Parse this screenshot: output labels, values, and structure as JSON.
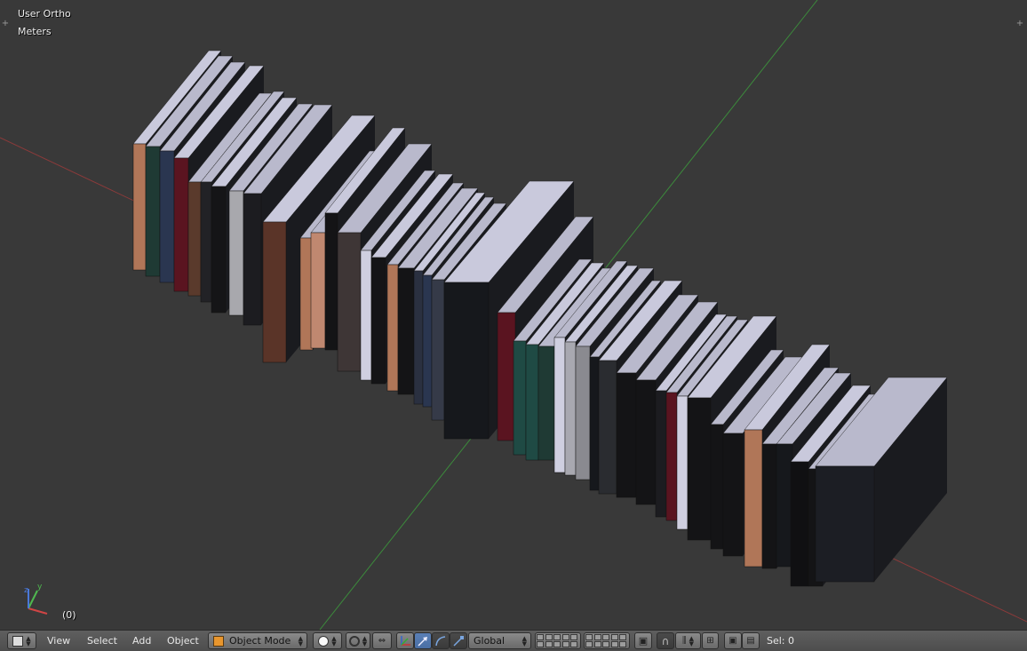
{
  "viewport": {
    "view_name": "User Ortho",
    "units": "Meters",
    "frame": "(0)"
  },
  "header": {
    "menus": [
      "View",
      "Select",
      "Add",
      "Object"
    ],
    "mode": "Object Mode",
    "orientation": "Global",
    "selection": "Sel: 0"
  },
  "icons": {
    "editor_type": "cube-icon",
    "shading": "solid-sphere-icon",
    "pivot": "pivot-icon",
    "manipulator": "manipulator-icon",
    "translate": "translate-icon",
    "rotate": "rotate-icon",
    "scale": "scale-icon",
    "layers": "layers-icon",
    "lock": "lock-icon",
    "snap": "magnet-icon",
    "snap_element": "snap-element-icon",
    "render": "camera-icon",
    "anim": "clapper-icon"
  },
  "colors": {
    "background": "#393939",
    "x_axis": "#8b3a3a",
    "y_axis": "#3c8b3c",
    "book_top": "#c9c9dc",
    "header": "#565656"
  }
}
